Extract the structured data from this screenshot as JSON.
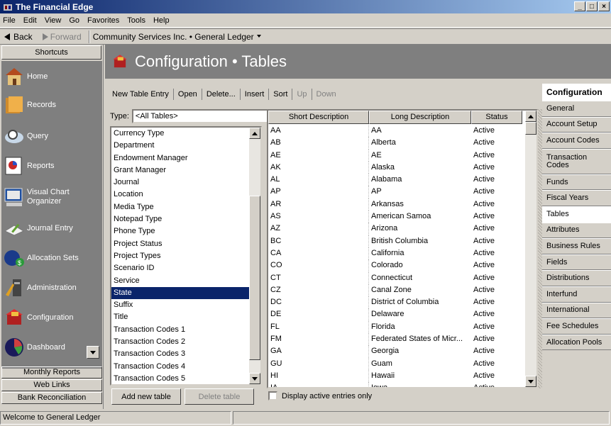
{
  "window": {
    "title": "The Financial Edge",
    "controls": [
      "_",
      "□",
      "×"
    ]
  },
  "menu": [
    "File",
    "Edit",
    "View",
    "Go",
    "Favorites",
    "Tools",
    "Help"
  ],
  "nav": {
    "back": "Back",
    "forward": "Forward",
    "breadcrumb": "Community Services Inc. • General Ledger"
  },
  "shortcuts": {
    "header": "Shortcuts",
    "items": [
      {
        "label": "Home",
        "icon": "home-icon"
      },
      {
        "label": "Records",
        "icon": "records-icon"
      },
      {
        "label": "Query",
        "icon": "query-icon"
      },
      {
        "label": "Reports",
        "icon": "reports-icon"
      },
      {
        "label": "Visual Chart Organizer",
        "icon": "chart-organizer-icon"
      },
      {
        "label": "Journal Entry",
        "icon": "journal-entry-icon"
      },
      {
        "label": "Allocation Sets",
        "icon": "allocation-sets-icon"
      },
      {
        "label": "Administration",
        "icon": "administration-icon"
      },
      {
        "label": "Configuration",
        "icon": "configuration-icon"
      },
      {
        "label": "Dashboard",
        "icon": "dashboard-icon"
      }
    ],
    "footer": [
      "Monthly Reports",
      "Web Links",
      "Bank Reconciliation"
    ]
  },
  "page": {
    "title": "Configuration • Tables"
  },
  "toolbar": {
    "new": "New Table Entry",
    "open": "Open",
    "delete": "Delete...",
    "insert": "Insert",
    "sort": "Sort",
    "up": "Up",
    "down": "Down"
  },
  "type": {
    "label": "Type:",
    "value": "<All Tables>"
  },
  "tables": [
    "Currency Type",
    "Department",
    "Endowment Manager",
    "Grant Manager",
    "Journal",
    "Location",
    "Media Type",
    "Notepad Type",
    "Phone Type",
    "Project Status",
    "Project Types",
    "Scenario ID",
    "Service",
    "State",
    "Suffix",
    "Title",
    "Transaction Codes 1",
    "Transaction Codes 2",
    "Transaction Codes 3",
    "Transaction Codes 4",
    "Transaction Codes 5"
  ],
  "selected_table": "State",
  "buttons": {
    "add": "Add new table",
    "delete": "Delete table"
  },
  "grid": {
    "columns": [
      "Short Description",
      "Long Description",
      "Status"
    ],
    "rows": [
      [
        "AA",
        "AA",
        "Active"
      ],
      [
        "AB",
        "Alberta",
        "Active"
      ],
      [
        "AE",
        "AE",
        "Active"
      ],
      [
        "AK",
        "Alaska",
        "Active"
      ],
      [
        "AL",
        "Alabama",
        "Active"
      ],
      [
        "AP",
        "AP",
        "Active"
      ],
      [
        "AR",
        "Arkansas",
        "Active"
      ],
      [
        "AS",
        "American Samoa",
        "Active"
      ],
      [
        "AZ",
        "Arizona",
        "Active"
      ],
      [
        "BC",
        "British Columbia",
        "Active"
      ],
      [
        "CA",
        "California",
        "Active"
      ],
      [
        "CO",
        "Colorado",
        "Active"
      ],
      [
        "CT",
        "Connecticut",
        "Active"
      ],
      [
        "CZ",
        "Canal Zone",
        "Active"
      ],
      [
        "DC",
        "District of Columbia",
        "Active"
      ],
      [
        "DE",
        "Delaware",
        "Active"
      ],
      [
        "FL",
        "Florida",
        "Active"
      ],
      [
        "FM",
        "Federated States of Micr...",
        "Active"
      ],
      [
        "GA",
        "Georgia",
        "Active"
      ],
      [
        "GU",
        "Guam",
        "Active"
      ],
      [
        "HI",
        "Hawaii",
        "Active"
      ],
      [
        "IA",
        "Iowa",
        "Active"
      ]
    ]
  },
  "display_active": "Display active entries only",
  "rightnav": {
    "header": "Configuration",
    "items": [
      "General",
      "Account Setup",
      "Account Codes",
      "Transaction Codes",
      "Funds",
      "Fiscal Years",
      "Tables",
      "Attributes",
      "Business Rules",
      "Fields",
      "Distributions",
      "Interfund",
      "International",
      "Fee Schedules",
      "Allocation Pools"
    ],
    "active": "Tables"
  },
  "status": {
    "text": "Welcome to General Ledger"
  }
}
